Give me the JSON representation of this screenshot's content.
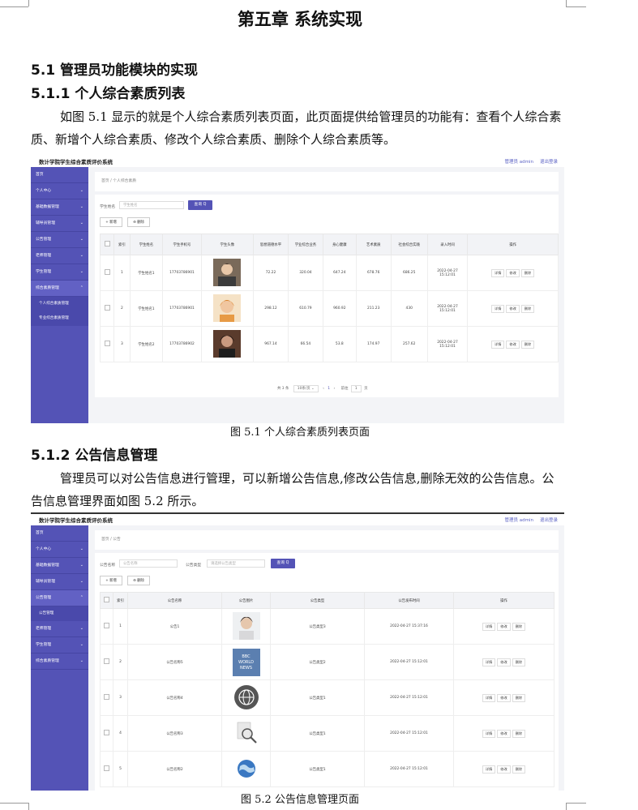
{
  "chapter_title": "第五章 系统实现",
  "sec_51": "5.1 管理员功能模块的实现",
  "sec_511": "5.1.1 个人综合素质列表",
  "para1": "如图 5.1 显示的就是个人综合素质列表页面，此页面提供给管理员的功能有：查看个人综合素质、新增个人综合素质、修改个人综合素质、删除个人综合素质等。",
  "caption1": "图 5.1 个人综合素质列表页面",
  "sec_512": "5.1.2 公告信息管理",
  "para2": "管理员可以对公告信息进行管理，可以新增公告信息,修改公告信息,删除无效的公告信息。公告信息管理界面如图 5.2 所示。",
  "caption2": "图 5.2 公告信息管理页面",
  "app": {
    "title": "数计学院学生综合素质评价系统",
    "user": "管理员 admin",
    "logout": "退出登录",
    "search_btn": "查询 Q",
    "add_btn": "+ 新增",
    "del_btn": "⊖ 删除",
    "op_detail": "详情",
    "op_edit": "修改",
    "op_delete": "删除"
  },
  "shot1": {
    "nav": [
      "首页",
      "个人中心",
      "基础数据管理",
      "辅导员管理",
      "公告管理",
      "老师管理",
      "学生管理",
      "综合素质管理"
    ],
    "subnav": [
      "个人综合素质管理",
      "专业综合素质管理"
    ],
    "crumb": "首页 / 个人综合素质",
    "search_label": "学生姓名",
    "search_placeholder": "学生姓名",
    "headers": [
      "索引",
      "学生姓名",
      "学生手机号",
      "学生头像",
      "思想道德水平",
      "学业综合业务",
      "身心健康",
      "艺术素质",
      "社会综合实践",
      "录入时间",
      "操作"
    ],
    "rows": [
      [
        "1",
        "学生姓名1",
        "17703786901",
        "72.22",
        "320.04",
        "647.24",
        "678.76",
        "686.25",
        "2022-04-27 15:12:01"
      ],
      [
        "2",
        "学生姓名1",
        "17703786901",
        "298.12",
        "610.79",
        "960.92",
        "211.23",
        "430",
        "2022-04-27 15:12:01"
      ],
      [
        "3",
        "学生姓名2",
        "17703786902",
        "967.14",
        "66.54",
        "53.8",
        "174.97",
        "257.62",
        "2022-04-27 15:12:01"
      ]
    ],
    "pager": {
      "total": "共 3 条",
      "size": "10条/页",
      "page": "1",
      "goto": "前往",
      "goto_page": "1",
      "unit": "页"
    }
  },
  "shot2": {
    "nav": [
      "首页",
      "个人中心",
      "基础数据管理",
      "辅导员管理",
      "公告管理",
      "老师管理",
      "学生管理",
      "综合素质管理"
    ],
    "subnav": [
      "公告管理"
    ],
    "crumb": "首页 / 公告",
    "search_label": "公告名称",
    "search_placeholder": "公告名称",
    "type_label": "公告类型",
    "type_placeholder": "请选择公告类型",
    "headers": [
      "索引",
      "公告名称",
      "公告图片",
      "公告类型",
      "公告发布时间",
      "操作"
    ],
    "rows": [
      [
        "1",
        "公告1",
        "公告类型3",
        "2022-04-27 15:37:16"
      ],
      [
        "2",
        "公告名称5",
        "公告类型2",
        "2022-04-27 15:12:01"
      ],
      [
        "3",
        "公告名称4",
        "公告类型1",
        "2022-04-27 15:12:01"
      ],
      [
        "4",
        "公告名称3",
        "公告类型1",
        "2022-04-27 15:12:01"
      ],
      [
        "5",
        "公告名称2",
        "公告类型1",
        "2022-04-27 15:12:01"
      ]
    ],
    "bbc_text": [
      "BBC",
      "WORLD",
      "NEWS"
    ]
  }
}
